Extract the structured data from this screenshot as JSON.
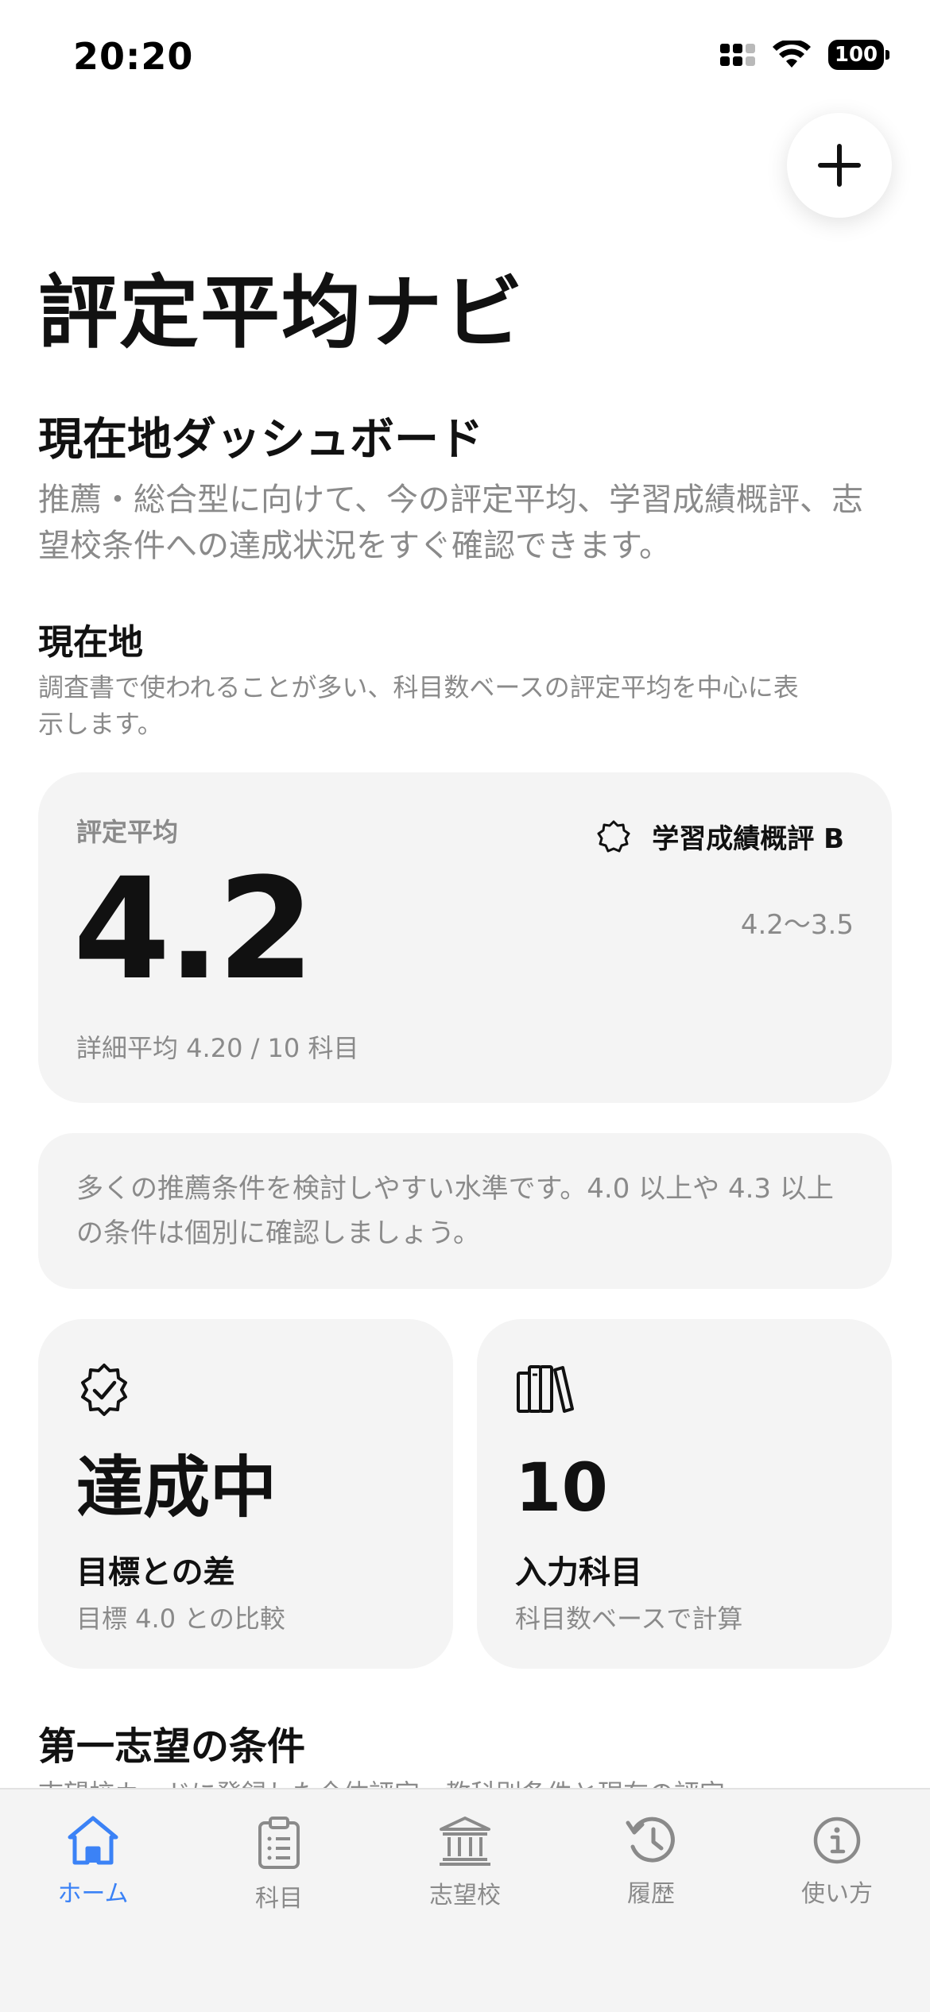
{
  "status_bar": {
    "time": "20:20",
    "battery": "100"
  },
  "header": {
    "app_title": "評定平均ナビ"
  },
  "dashboard": {
    "title": "現在地ダッシュボード",
    "description": "推薦・総合型に向けて、今の評定平均、学習成績概評、志望校条件への達成状況をすぐ確認できます。"
  },
  "current": {
    "title": "現在地",
    "description": "調査書で使われることが多い、科目数ベースの評定平均を中心に表示します。"
  },
  "main_card": {
    "label": "評定平均",
    "value": "4.2",
    "detail": "詳細平均 4.20 / 10 科目",
    "grade": "学習成績概評 B",
    "range": "4.2〜3.5"
  },
  "note": {
    "text": "多くの推薦条件を検討しやすい水準です。4.0 以上や 4.3 以上の条件は個別に確認しましょう。"
  },
  "stats": [
    {
      "icon": "check-badge-icon",
      "value": "達成中",
      "label": "目標との差",
      "sub": "目標 4.0 との比較"
    },
    {
      "icon": "books-icon",
      "value": "10",
      "label": "入力科目",
      "sub": "科目数ベースで計算"
    }
  ],
  "next_section": {
    "title": "第一志望の条件",
    "description": "志望校カードに登録した全体評定・教科別条件と現在の評定"
  },
  "tabs": [
    {
      "label": "ホーム",
      "icon": "home-icon",
      "active": true
    },
    {
      "label": "科目",
      "icon": "clipboard-icon",
      "active": false
    },
    {
      "label": "志望校",
      "icon": "school-icon",
      "active": false
    },
    {
      "label": "履歴",
      "icon": "history-icon",
      "active": false
    },
    {
      "label": "使い方",
      "icon": "info-icon",
      "active": false
    }
  ],
  "colors": {
    "accent": "#3b82f6",
    "card_bg": "#f4f4f4",
    "muted_text": "#8a8a8a"
  }
}
